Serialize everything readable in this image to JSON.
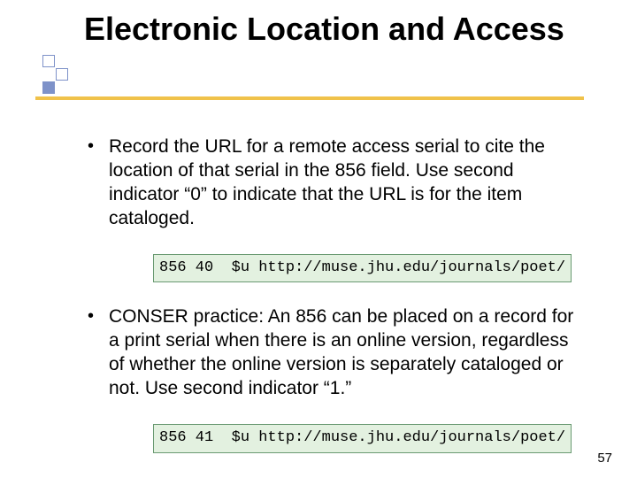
{
  "title": "Electronic Location and Access",
  "bullets": [
    "Record the URL for a remote access serial to cite the location of that serial in the 856 field. Use second indicator “0” to indicate that the URL is for the item cataloged.",
    "CONSER practice: An 856 can be placed on a record for a print serial when there is an online version, regardless of whether the online version is separately cataloged or not.  Use second indicator “1.”"
  ],
  "code": [
    "856 40  $u http://muse.jhu.edu/journals/poet/",
    "856 41  $u http://muse.jhu.edu/journals/poet/"
  ],
  "page_number": "57"
}
